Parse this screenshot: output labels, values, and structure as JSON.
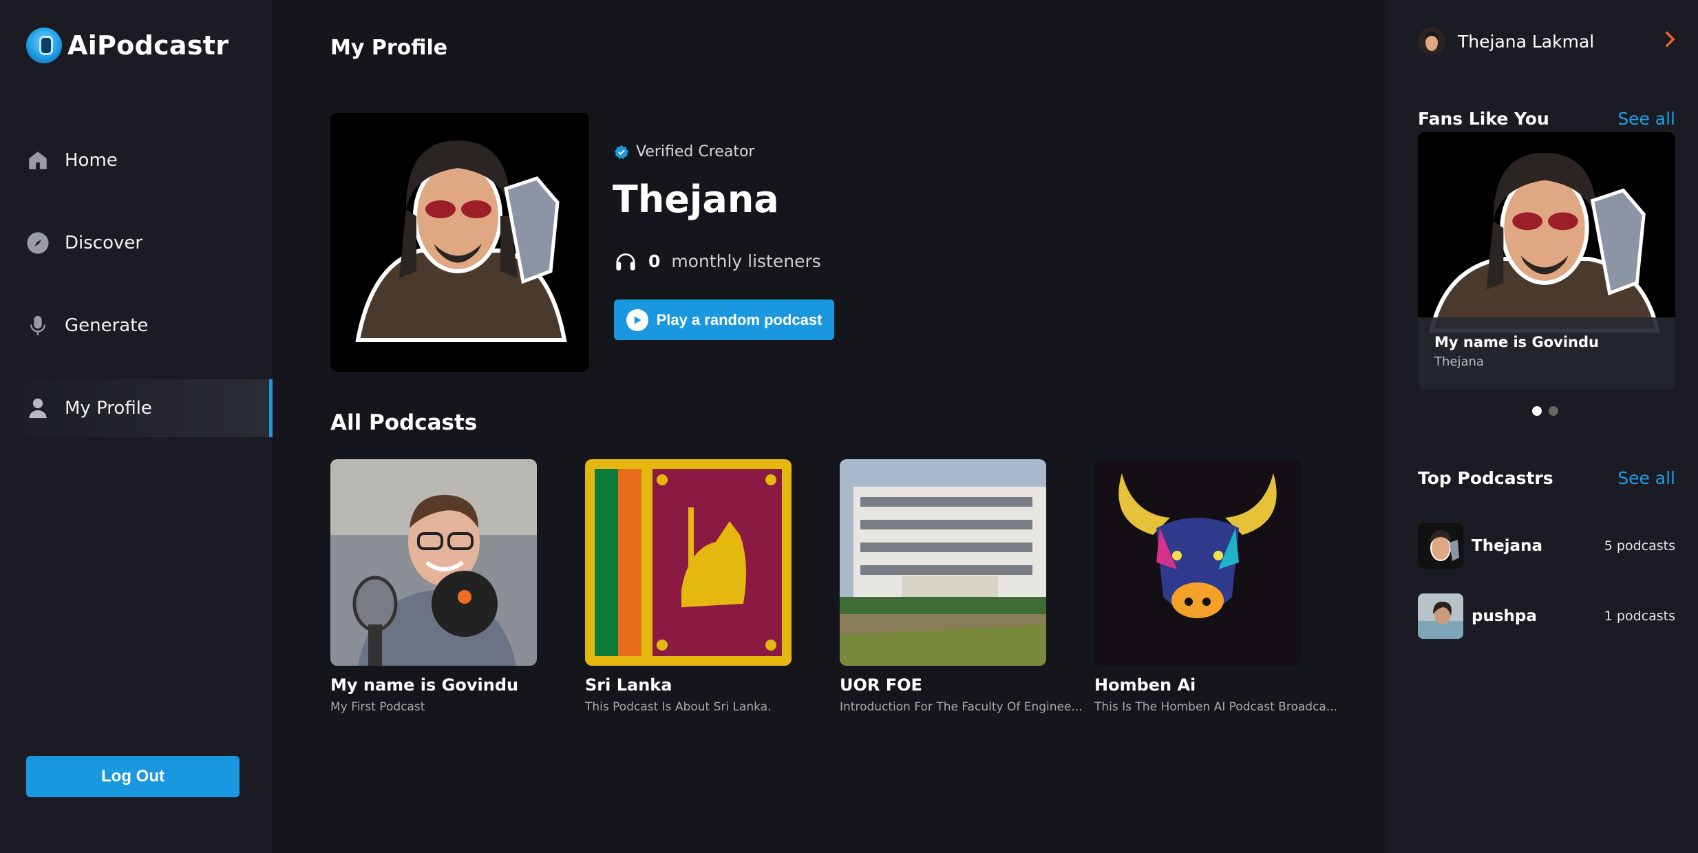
{
  "app": {
    "name": "AiPodcastr"
  },
  "sidebar": {
    "items": [
      {
        "label": "Home",
        "icon": "home-icon"
      },
      {
        "label": "Discover",
        "icon": "compass-icon"
      },
      {
        "label": "Generate",
        "icon": "microphone-icon"
      },
      {
        "label": "My Profile",
        "icon": "user-icon",
        "active": true
      }
    ],
    "logout_label": "Log Out"
  },
  "main": {
    "page_title": "My Profile",
    "profile": {
      "verified_label": "Verified Creator",
      "name": "Thejana",
      "listeners_count": "0",
      "listeners_label": "monthly listeners",
      "play_label": "Play a random podcast"
    },
    "section_title": "All Podcasts",
    "podcasts": [
      {
        "title": "My name is Govindu",
        "description": "My First Podcast"
      },
      {
        "title": "Sri Lanka",
        "description": "This Podcast Is About Sri Lanka."
      },
      {
        "title": "UOR FOE",
        "description": "Introduction For The Faculty Of Enginee..."
      },
      {
        "title": "Homben Ai",
        "description": "This Is The Homben AI Podcast Broadca..."
      }
    ]
  },
  "right": {
    "user_name": "Thejana Lakmal",
    "fans": {
      "title": "Fans Like You",
      "see_all": "See all",
      "card_title": "My name is Govindu",
      "card_subtitle": "Thejana",
      "active_slide": 1,
      "slides": 2
    },
    "top": {
      "title": "Top Podcastrs",
      "see_all": "See all",
      "items": [
        {
          "name": "Thejana",
          "count": "5 podcasts"
        },
        {
          "name": "pushpa",
          "count": "1 podcasts"
        }
      ]
    }
  },
  "colors": {
    "accent": "#1a98df",
    "chevron": "#f4632c",
    "background": "#15161b",
    "panel": "#1b1c23"
  }
}
